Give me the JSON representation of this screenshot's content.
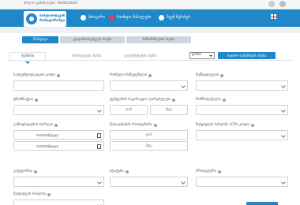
{
  "topbar": {
    "notice": "ბოლო განახლება: 20/06/2020"
  },
  "header": {
    "logo_line1": "ბიბლიოთეკის",
    "logo_line2": "მონიტორინგი",
    "nav": [
      {
        "label": "მთავარი",
        "icon": "home-icon"
      },
      {
        "label": "საინფო მასალები",
        "icon": "alert-icon"
      },
      {
        "label": "ჩვენ შესახებ",
        "icon": "info-icon"
      }
    ],
    "language_flag": "uk-flag-icon"
  },
  "primary_tabs": [
    "მარტივი",
    "გაფართოებული ძიება",
    "ნაწარმოების ძიება"
  ],
  "sub_tabs": [
    "ძებნისი",
    "მიწოდების ძებნა",
    "ელემენტების ძებნა"
  ],
  "language_select": "ქართ",
  "search_button": "საჯარო ფინანსების ძებნა",
  "fields": {
    "row1": [
      {
        "label": "საიდენტიფიკაციო კოდი",
        "value": ""
      },
      {
        "label": "რომელი მაწვდენელი",
        "value": ""
      },
      {
        "label": "შემსყიდველი",
        "value": ""
      }
    ],
    "row2": [
      {
        "label": "ტრანზაქცია",
        "value": ""
      },
      {
        "label": "ტენდერის სავარაუდო ღირებულება",
        "from": "დან",
        "to": "მდე"
      },
      {
        "label": "მომწოდებელი",
        "value": ""
      }
    ],
    "row3": [
      {
        "label": "გამოცხადების თარიღი",
        "date1": "mm/dd/yyyy",
        "date2": "mm/dd/yyyy"
      },
      {
        "label": "შეთავაზების რაოდენობა",
        "from": "დან",
        "to": "მდე"
      },
      {
        "label": "შესყიდვის სახეობა (CPV კოდი)",
        "value": ""
      }
    ],
    "row4": [
      {
        "label": "კატეგორია",
        "value": ""
      },
      {
        "label": "სტატუსი",
        "value": ""
      },
      {
        "label": "პროცედურა",
        "value": ""
      }
    ],
    "row5": [
      {
        "label": "შესყიდვის სახეობა",
        "value": ""
      }
    ]
  },
  "colors": {
    "brand": "#1e88c8",
    "alert": "#e8413c"
  }
}
